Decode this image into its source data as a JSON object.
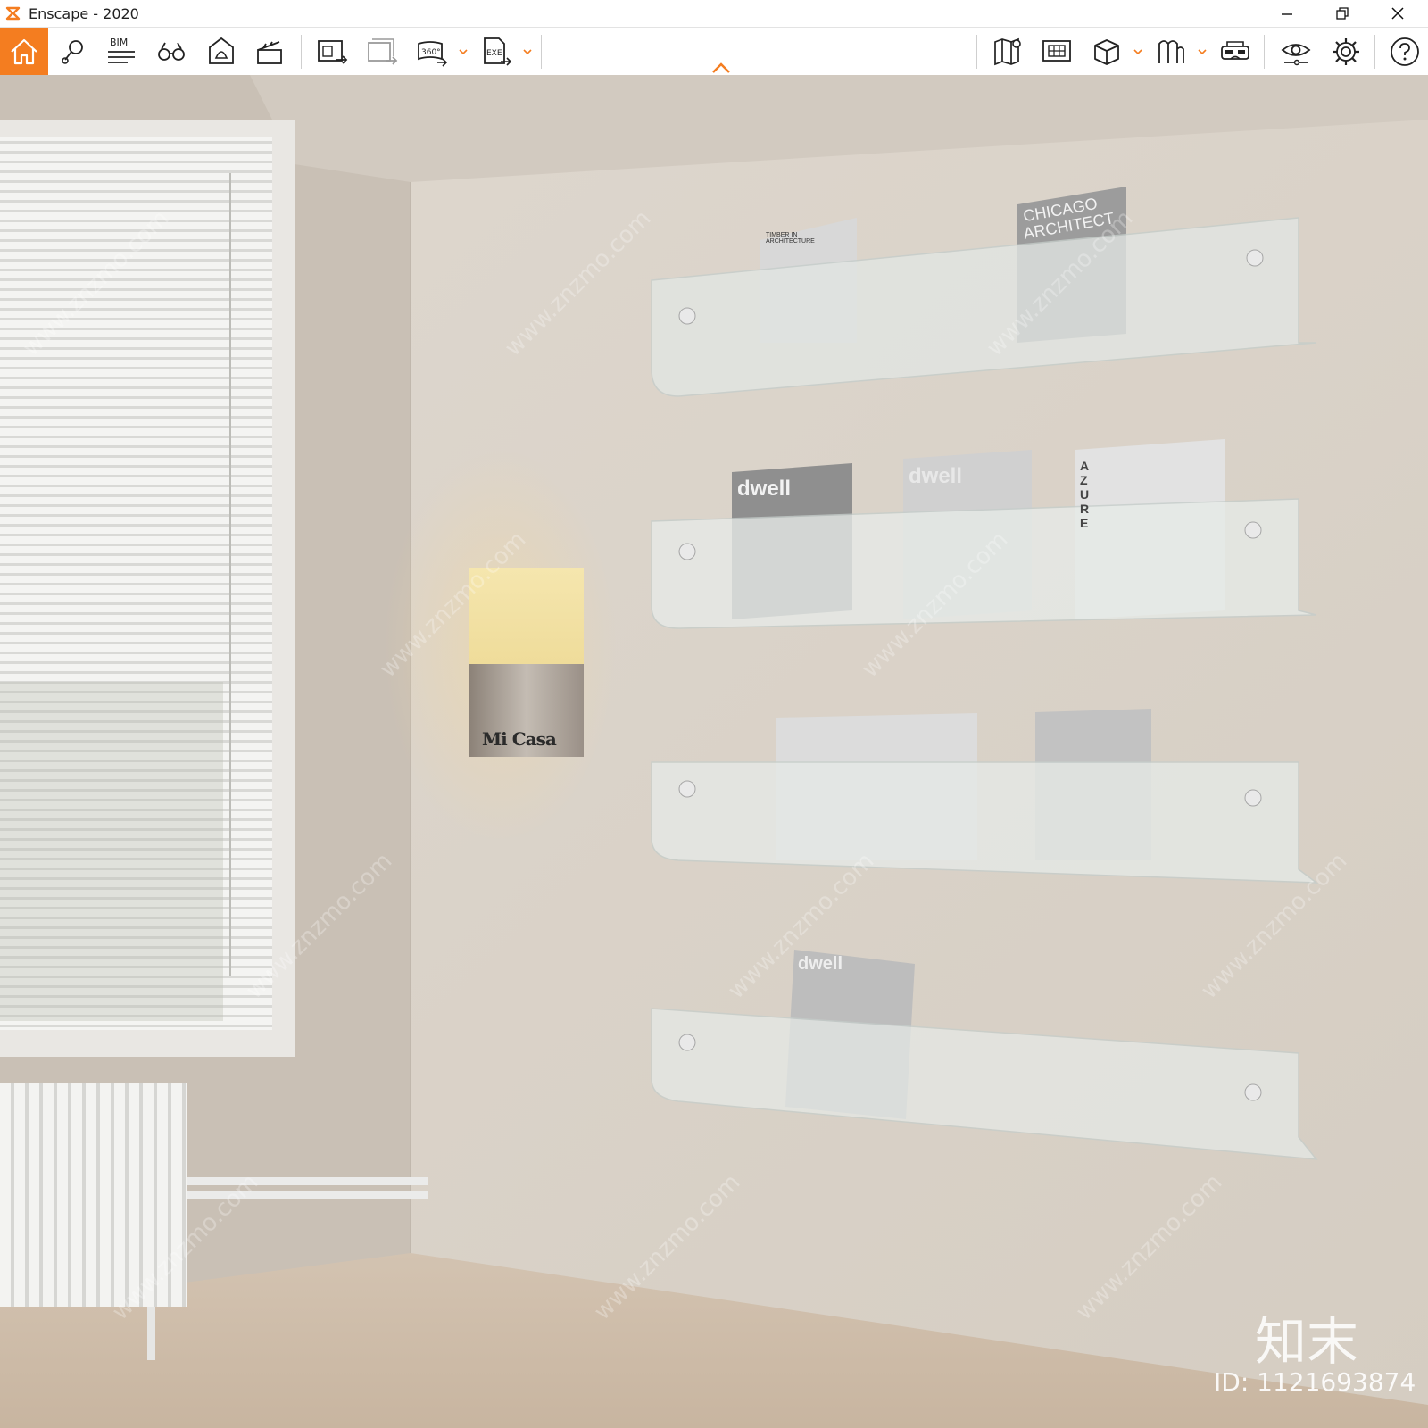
{
  "window": {
    "title": "Enscape - 2020",
    "controls": [
      "minimize",
      "restore",
      "close"
    ]
  },
  "toolbar": {
    "accent_color": "#f47d20",
    "bim_label": "BIM",
    "pano_label": "360°",
    "exe_label": "EXE",
    "items": [
      {
        "name": "home-icon"
      },
      {
        "name": "location-pin-icon"
      },
      {
        "name": "bim-icon"
      },
      {
        "name": "binoculars-icon"
      },
      {
        "name": "light-icon"
      },
      {
        "name": "clapper-icon"
      },
      {
        "name": "screenshot-export-icon"
      },
      {
        "name": "batch-export-icon"
      },
      {
        "name": "panorama-360-icon"
      },
      {
        "name": "exe-export-icon"
      },
      {
        "name": "map-icon"
      },
      {
        "name": "view-management-icon"
      },
      {
        "name": "asset-library-icon"
      },
      {
        "name": "material-icon"
      },
      {
        "name": "vr-headset-icon"
      },
      {
        "name": "visual-settings-icon"
      },
      {
        "name": "settings-icon"
      },
      {
        "name": "help-icon"
      }
    ]
  },
  "scene": {
    "sign_text": "Mi Casa",
    "magazines": {
      "top_left": "TIMBER IN ARCHITECTURE",
      "top_right_line1": "CHICAGO",
      "top_right_line2": "ARCHITECT",
      "dwell": "dwell",
      "azure": "AZURE"
    },
    "watermark_site": "www.znzmo.com",
    "watermark_logo": "知末",
    "watermark_id": "ID: 1121693874"
  }
}
